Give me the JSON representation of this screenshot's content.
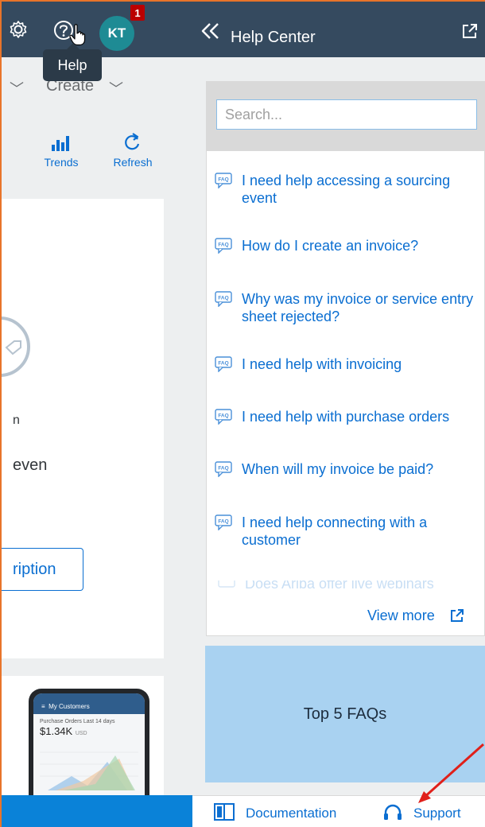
{
  "header": {
    "avatar_initials": "KT",
    "notification_count": "1",
    "tooltip": "Help",
    "icons": [
      "gear-icon",
      "help-circle-icon",
      "hand-cursor-icon"
    ]
  },
  "app": {
    "menu": {
      "create_label": "Create"
    },
    "toolbar": {
      "trends_label": "Trends",
      "refresh_label": "Refresh"
    },
    "card": {
      "fragment_text": "n",
      "fragment_even": "even",
      "subscription_button": "ription"
    },
    "promo_phone": {
      "header": "My Customers",
      "subtitle": "Purchase Orders Last 14 days",
      "amount": "$1.34K",
      "currency": "USD"
    }
  },
  "help_center": {
    "title": "Help Center",
    "search_placeholder": "Search...",
    "faq_items": [
      "I need help accessing a sourcing event",
      "How do I create an invoice?",
      "Why was my invoice or service entry sheet rejected?",
      "I need help with invoicing",
      "I need help with purchase orders",
      "When will my invoice be paid?",
      "I need help connecting with a customer",
      "Does Ariba offer live webinars"
    ],
    "view_more": "View more",
    "top5_label": "Top 5 FAQs",
    "footer": {
      "documentation_label": "Documentation",
      "support_label": "Support"
    }
  },
  "colors": {
    "shell_header": "#354a5f",
    "accent_blue": "#0a6ed1",
    "highlight_outline": "#e8742a",
    "top5_tile": "#a9d2f1",
    "badge_red": "#bb0000",
    "avatar_teal": "#1e8b94",
    "annotation_arrow": "#e0201a"
  }
}
